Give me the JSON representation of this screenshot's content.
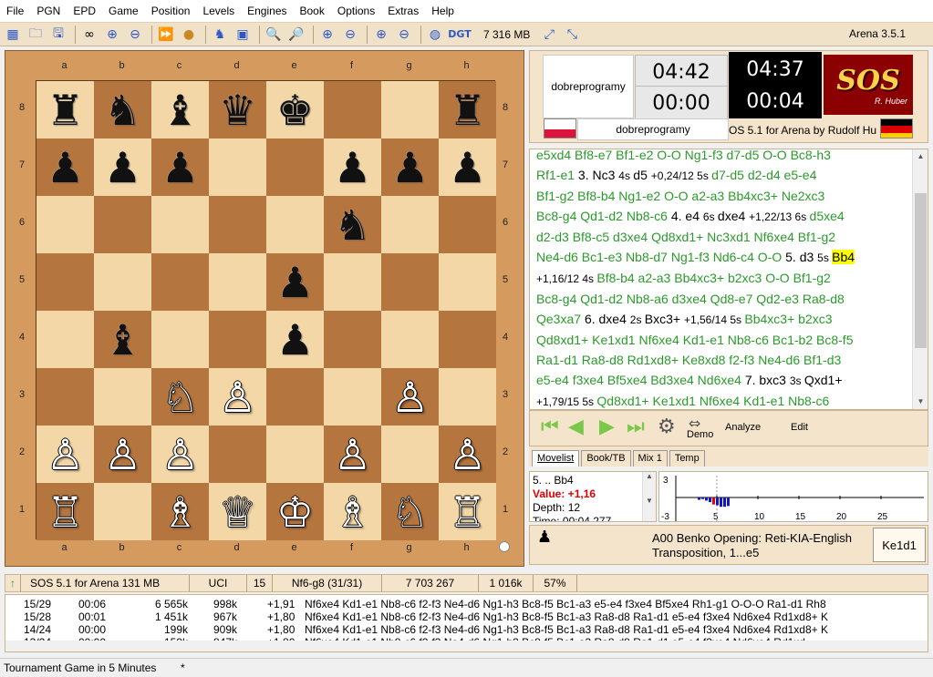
{
  "menu": [
    "File",
    "PGN",
    "EPD",
    "Game",
    "Position",
    "Levels",
    "Engines",
    "Book",
    "Options",
    "Extras",
    "Help"
  ],
  "toolbar": {
    "memory": "7 316 MB",
    "version": "Arena 3.5.1"
  },
  "board": {
    "files": [
      "a",
      "b",
      "c",
      "d",
      "e",
      "f",
      "g",
      "h"
    ],
    "ranks": [
      "8",
      "7",
      "6",
      "5",
      "4",
      "3",
      "2",
      "1"
    ],
    "position": [
      [
        "♜",
        "♞",
        "♝",
        "♛",
        "♚",
        "",
        "",
        "♜"
      ],
      [
        "♟",
        "♟",
        "♟",
        "",
        "",
        "♟",
        "♟",
        "♟"
      ],
      [
        "",
        "",
        "",
        "",
        "",
        "♞",
        "",
        ""
      ],
      [
        "",
        "",
        "",
        "",
        "♟",
        "",
        "",
        ""
      ],
      [
        "",
        "♝",
        "",
        "",
        "♟",
        "",
        "",
        ""
      ],
      [
        "",
        "",
        "♘",
        "♙",
        "",
        "",
        "♙",
        ""
      ],
      [
        "♙",
        "♙",
        "♙",
        "",
        "",
        "♙",
        "",
        "♙"
      ],
      [
        "♖",
        "",
        "♗",
        "♕",
        "♔",
        "♗",
        "♘",
        "♖"
      ]
    ],
    "colors": [
      [
        "b",
        "b",
        "b",
        "b",
        "b",
        "",
        "",
        "b"
      ],
      [
        "b",
        "b",
        "b",
        "",
        "",
        "b",
        "b",
        "b"
      ],
      [
        "",
        "",
        "",
        "",
        "",
        "b",
        "",
        ""
      ],
      [
        "",
        "",
        "",
        "",
        "b",
        "",
        "",
        ""
      ],
      [
        "",
        "b",
        "",
        "",
        "b",
        "",
        "",
        ""
      ],
      [
        "",
        "",
        "w",
        "w",
        "",
        "",
        "w",
        ""
      ],
      [
        "w",
        "w",
        "w",
        "",
        "",
        "w",
        "",
        "w"
      ],
      [
        "w",
        "",
        "w",
        "w",
        "w",
        "w",
        "w",
        "w"
      ]
    ]
  },
  "clock": {
    "white_name": "dobreprogramy",
    "black_name": "dobreprogramy",
    "white_time": "04:42",
    "white_move_time": "00:00",
    "black_time": "04:37",
    "black_move_time": "00:04",
    "engine_name": "OS 5.1 for Arena by Rudolf Hu",
    "logo": "SOS",
    "logo_sub": "R. Huber"
  },
  "movelist": {
    "lines": [
      [
        {
          "t": "e5xd4 Bf8-e7 Bf1-e2 O-O Ng1-f3 d7-d5 O-O Bc8-h3",
          "c": "g"
        }
      ],
      [
        {
          "t": "Rf1-e1 ",
          "c": "g"
        },
        {
          "t": "3. Nc3 ",
          "c": "m"
        },
        {
          "t": "4s ",
          "c": "s"
        },
        {
          "t": "d5 ",
          "c": "m"
        },
        {
          "t": "+0,24/12 5s ",
          "c": "s"
        },
        {
          "t": " d7-d5 d2-d4 e5-e4",
          "c": "g"
        }
      ],
      [
        {
          "t": "Bf1-g2 Bf8-b4 Ng1-e2 O-O a2-a3 Bb4xc3+ Ne2xc3",
          "c": "g"
        }
      ],
      [
        {
          "t": "Bc8-g4 Qd1-d2 Nb8-c6 ",
          "c": "g"
        },
        {
          "t": "4. e4 ",
          "c": "m"
        },
        {
          "t": "6s ",
          "c": "s"
        },
        {
          "t": "dxe4 ",
          "c": "m"
        },
        {
          "t": "+1,22/13 6s ",
          "c": "s"
        },
        {
          "t": " d5xe4",
          "c": "g"
        }
      ],
      [
        {
          "t": "d2-d3 Bf8-c5 d3xe4 Qd8xd1+ Nc3xd1 Nf6xe4 Bf1-g2",
          "c": "g"
        }
      ],
      [
        {
          "t": "Ne4-d6 Bc1-e3 Nb8-d7 Ng1-f3 Nd6-c4 O-O ",
          "c": "g"
        },
        {
          "t": "5. d3 ",
          "c": "m"
        },
        {
          "t": "5s ",
          "c": "s"
        },
        {
          "t": "Bb4",
          "c": "h"
        }
      ],
      [
        {
          "t": "+1,16/12 4s ",
          "c": "s"
        },
        {
          "t": " Bf8-b4 a2-a3 Bb4xc3+ b2xc3 O-O Bf1-g2",
          "c": "g"
        }
      ],
      [
        {
          "t": "Bc8-g4 Qd1-d2 Nb8-a6 d3xe4 Qd8-e7 Qd2-e3 Ra8-d8",
          "c": "g"
        }
      ],
      [
        {
          "t": "Qe3xa7 ",
          "c": "g"
        },
        {
          "t": "6. dxe4 ",
          "c": "m"
        },
        {
          "t": "2s ",
          "c": "s"
        },
        {
          "t": "Bxc3+ ",
          "c": "m"
        },
        {
          "t": "+1,56/14 5s ",
          "c": "s"
        },
        {
          "t": " Bb4xc3+ b2xc3",
          "c": "g"
        }
      ],
      [
        {
          "t": "Qd8xd1+ Ke1xd1 Nf6xe4 Kd1-e1 Nb8-c6 Bc1-b2 Bc8-f5",
          "c": "g"
        }
      ],
      [
        {
          "t": "Ra1-d1 Ra8-d8 Rd1xd8+ Ke8xd8 f2-f3 Ne4-d6 Bf1-d3",
          "c": "g"
        }
      ],
      [
        {
          "t": "e5-e4 f3xe4 Bf5xe4 Bd3xe4 Nd6xe4 ",
          "c": "g"
        },
        {
          "t": "7. bxc3 ",
          "c": "m"
        },
        {
          "t": "3s ",
          "c": "s"
        },
        {
          "t": "Qxd1+",
          "c": "m"
        }
      ],
      [
        {
          "t": "+1,79/15 5s ",
          "c": "s"
        },
        {
          "t": " Qd8xd1+ Ke1xd1 Nf6xe4 Kd1-e1 Nb8-c6",
          "c": "g"
        }
      ]
    ]
  },
  "nav": {
    "demo": "Demo",
    "analyze": "Analyze",
    "edit": "Edit"
  },
  "tabs": [
    "Movelist",
    "Book/TB",
    "Mix 1",
    "Temp"
  ],
  "eval": {
    "move": "5. .. Bb4",
    "value_label": "Value: +1,16",
    "depth": "Depth: 12",
    "time": "Time: 00:04.277"
  },
  "graph": {
    "y_top": "3",
    "y_bottom": "-3",
    "x_ticks": [
      "5",
      "10",
      "15",
      "20",
      "25"
    ],
    "values": [
      0.3,
      0.2,
      0.4,
      0.6,
      0.9,
      1.0,
      1.2,
      1.2,
      1.1
    ],
    "marker_index": 4
  },
  "opening": {
    "code_name": "A00  Benko Opening: Reti-KIA-English",
    "line2": "Transposition, 1...e5",
    "move": "Ke1d1"
  },
  "engine_status": {
    "engine": "SOS 5.1 for Arena  131 MB",
    "protocol": "UCI",
    "depth": "15",
    "current": "Nf6-g8 (31/31)",
    "nodes": "7 703 267",
    "nps": "1 016k",
    "load": "57%"
  },
  "engine_lines": [
    {
      "depth": "15/29",
      "time": "00:06",
      "nodes": "6 565k",
      "nps": "998k",
      "score": "+1,91",
      "pv": "Nf6xe4  Kd1-e1  Nb8-c6  f2-f3  Ne4-d6  Ng1-h3  Bc8-f5  Bc1-a3  e5-e4  f3xe4  Bf5xe4  Rh1-g1  O-O-O  Ra1-d1  Rh8"
    },
    {
      "depth": "15/28",
      "time": "00:01",
      "nodes": "1 451k",
      "nps": "967k",
      "score": "+1,80",
      "pv": "Nf6xe4  Kd1-e1  Nb8-c6  f2-f3  Ne4-d6  Ng1-h3  Bc8-f5  Bc1-a3  Ra8-d8  Ra1-d1  e5-e4  f3xe4  Nd6xe4  Rd1xd8+  K"
    },
    {
      "depth": "14/24",
      "time": "00:00",
      "nodes": "199k",
      "nps": "909k",
      "score": "+1,80",
      "pv": "Nf6xe4  Kd1-e1  Nb8-c6  f2-f3  Ne4-d6  Ng1-h3  Bc8-f5  Bc1-a3  Ra8-d8  Ra1-d1  e5-e4  f3xe4  Nd6xe4  Rd1xd8+  K"
    },
    {
      "depth": "13/24",
      "time": "00:00",
      "nodes": "159k",
      "nps": "847k",
      "score": "+1,80",
      "pv": "Nf6xe4  Kd1-e1  Nb8-c6  f2-f3  Ne4-d6  Ng1-h3  Bc8-f5  Bc1-a3  Ra8-d8  Ra1-d1  e5-e4  f3xe4  Nd6xe4  Rd1xd"
    }
  ],
  "statusbar": {
    "text": "Tournament Game in 5 Minutes",
    "mark": "*"
  },
  "colors": {
    "wood": "#d49a5e",
    "light_square": "#f3d7a6",
    "dark_square": "#b5753e",
    "movelist_green": "#2b9a2b",
    "panel": "#f3e4cb"
  }
}
